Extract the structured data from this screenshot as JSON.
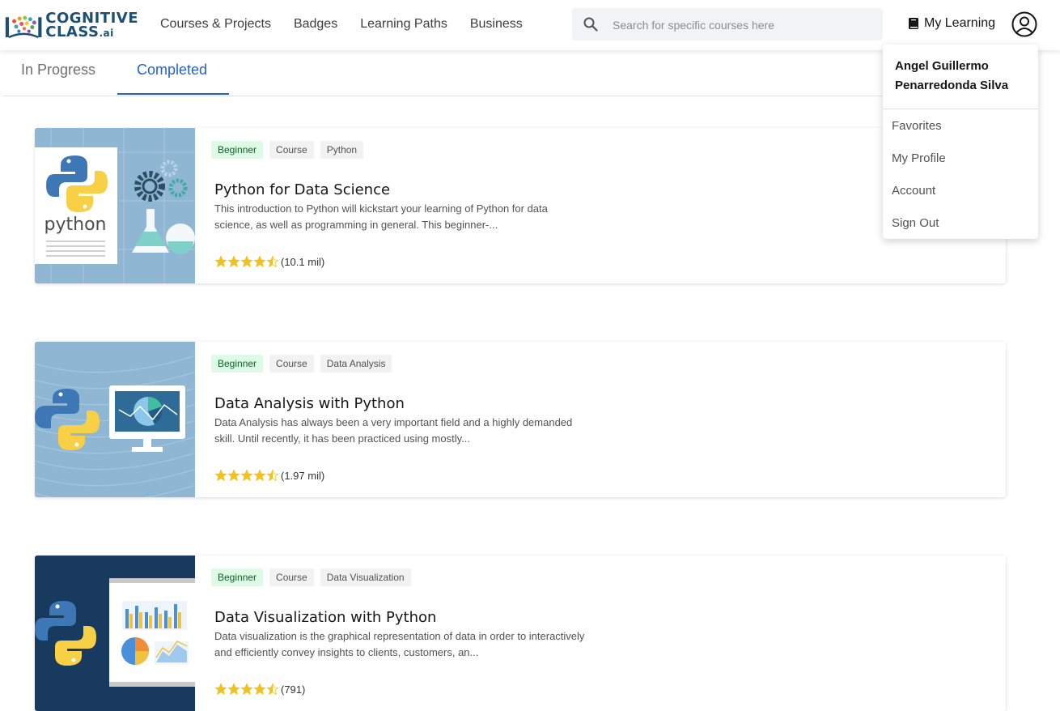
{
  "logo": {
    "line1": "COGNITIVE",
    "line2": "CLASS",
    "suffix": ".ai"
  },
  "nav": [
    {
      "label": "Courses & Projects"
    },
    {
      "label": "Badges"
    },
    {
      "label": "Learning Paths"
    },
    {
      "label": "Business"
    }
  ],
  "search": {
    "placeholder": "Search for specific courses here",
    "icon": "search-icon"
  },
  "header": {
    "my_learning": "My Learning",
    "book_icon": "book-icon",
    "avatar_icon": "user-avatar-icon"
  },
  "tabs": [
    {
      "label": "In Progress",
      "active": false
    },
    {
      "label": "Completed",
      "active": true
    }
  ],
  "courses": [
    {
      "tags": [
        "Beginner",
        "Course",
        "Python"
      ],
      "title": "Python for Data Science",
      "description": "This introduction to Python will kickstart your learning of Python for data science, as well as programming in general. This beginner-...",
      "rating_stars": 4.5,
      "rating_count": "(10.1 mil)",
      "thumb_label": "python"
    },
    {
      "tags": [
        "Beginner",
        "Course",
        "Data Analysis"
      ],
      "title": "Data Analysis with Python",
      "description": "Data Analysis has always been a very important field and a highly demanded skill. Until recently, it has been practiced using mostly...",
      "rating_stars": 4.5,
      "rating_count": "(1.97 mil)"
    },
    {
      "tags": [
        "Beginner",
        "Course",
        "Data Visualization"
      ],
      "title": "Data Visualization with Python",
      "description": "Data visualization is the graphical representation of data in order to interactively and efficiently convey insights to clients, customers, an...",
      "rating_stars": 4.5,
      "rating_count": "(791)"
    }
  ],
  "dropdown": {
    "user_name": "Angel Guillermo Penarredonda Silva",
    "items": [
      {
        "label": "Favorites"
      },
      {
        "label": "My Profile"
      },
      {
        "label": "Account"
      },
      {
        "label": "Sign Out"
      }
    ]
  },
  "colors": {
    "brand": "#1d4f73",
    "accent": "#2563c9",
    "star": "#f1c21b",
    "beginner_bg": "#defbe6"
  }
}
